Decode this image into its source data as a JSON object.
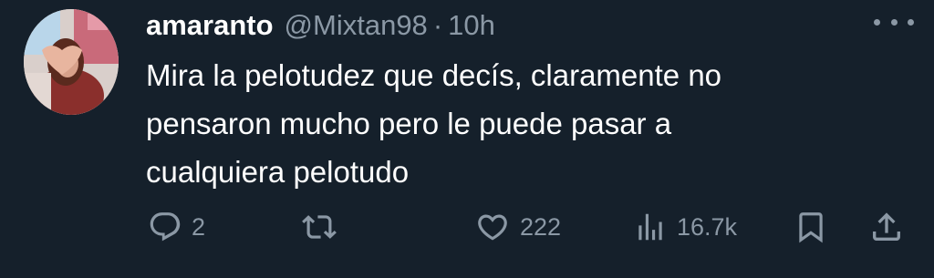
{
  "tweet": {
    "author": {
      "name": "amaranto",
      "handle": "@Mixtan98",
      "separator": "·",
      "time": "10h"
    },
    "text_lines": [
      "Mira la pelotudez que decís, claramente no",
      "pensaron mucho pero le puede pasar a",
      "cualquiera pelotudo"
    ],
    "actions": {
      "reply": {
        "icon": "reply-icon",
        "count": "2"
      },
      "retweet": {
        "icon": "retweet-icon",
        "count": ""
      },
      "like": {
        "icon": "heart-icon",
        "count": "222"
      },
      "views": {
        "icon": "views-icon",
        "count": "16.7k"
      },
      "bookmark": {
        "icon": "bookmark-icon"
      },
      "share": {
        "icon": "share-icon"
      }
    },
    "colors": {
      "background": "#15202b",
      "primary_text": "#ffffff",
      "secondary_text": "#8b98a5"
    }
  }
}
